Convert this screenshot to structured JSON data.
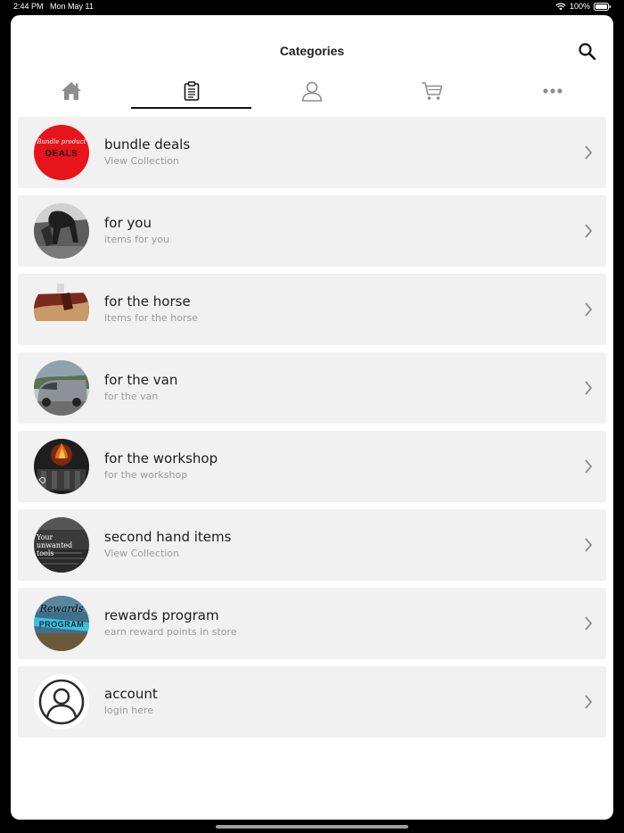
{
  "status": {
    "time": "2:44 PM",
    "date": "Mon May 11",
    "battery": "100%"
  },
  "header": {
    "title": "Categories"
  },
  "tabs": [
    {
      "name": "home-icon",
      "active": false
    },
    {
      "name": "clipboard-icon",
      "active": true
    },
    {
      "name": "user-icon",
      "active": false
    },
    {
      "name": "cart-icon",
      "active": false
    },
    {
      "name": "more-icon",
      "active": false
    }
  ],
  "items": [
    {
      "title": "bundle deals",
      "subtitle": "View Collection",
      "thumb_script": "Bundle product",
      "thumb_label": "DEALS"
    },
    {
      "title": "for you",
      "subtitle": "items for you"
    },
    {
      "title": "for the horse",
      "subtitle": "items for the horse"
    },
    {
      "title": "for the van",
      "subtitle": "for the van"
    },
    {
      "title": "for the workshop",
      "subtitle": "for the workshop"
    },
    {
      "title": "second hand items",
      "subtitle": "View Collection",
      "thumb_label": "Your unwanted tools"
    },
    {
      "title": "rewards program",
      "subtitle": "earn reward points in store",
      "thumb_script": "Rewards",
      "thumb_label": "PROGRAM"
    },
    {
      "title": "account",
      "subtitle": "login here"
    }
  ],
  "colors": {
    "accent": "#111111",
    "row_bg": "#f1f1f1",
    "subtitle": "#9a9a9a",
    "deals_red": "#e8141b"
  }
}
